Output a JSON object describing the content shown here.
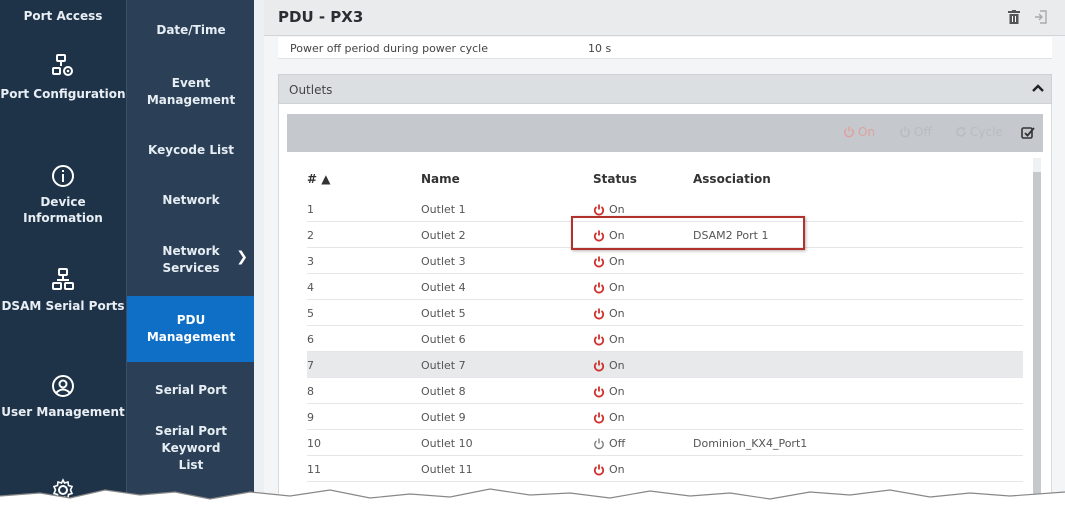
{
  "rail": {
    "items": [
      {
        "label": "Port Access",
        "icon": "port-access-icon"
      },
      {
        "label": "Port Configuration",
        "icon": "network-gear-icon"
      },
      {
        "label": "Device Information",
        "icon": "info-icon"
      },
      {
        "label": "DSAM Serial Ports",
        "icon": "serial-ports-icon"
      },
      {
        "label": "User Management",
        "icon": "user-icon"
      },
      {
        "label": "",
        "icon": "settings-gear-icon"
      }
    ]
  },
  "submenu": {
    "items": [
      {
        "label": "Date/Time"
      },
      {
        "label": "Event Management"
      },
      {
        "label": "Keycode List"
      },
      {
        "label": "Network"
      },
      {
        "label": "Network Services"
      },
      {
        "label": "PDU Management",
        "active": true
      },
      {
        "label": "Serial Port"
      },
      {
        "label": "Serial Port Keyword List"
      }
    ]
  },
  "header": {
    "title": "PDU - PX3",
    "delete_icon": "trash-icon",
    "exit_icon": "logout-icon"
  },
  "property": {
    "label": "Power off period during power cycle",
    "value": "10 s"
  },
  "outlets": {
    "section_title": "Outlets",
    "toolbar": {
      "on_label": "On",
      "off_label": "Off",
      "cycle_label": "Cycle"
    },
    "columns": {
      "num": "# ▲",
      "name": "Name",
      "status": "Status",
      "association": "Association"
    },
    "rows": [
      {
        "num": "1",
        "name": "Outlet 1",
        "status": "On",
        "association": ""
      },
      {
        "num": "2",
        "name": "Outlet 2",
        "status": "On",
        "association": "DSAM2 Port 1"
      },
      {
        "num": "3",
        "name": "Outlet 3",
        "status": "On",
        "association": ""
      },
      {
        "num": "4",
        "name": "Outlet 4",
        "status": "On",
        "association": ""
      },
      {
        "num": "5",
        "name": "Outlet 5",
        "status": "On",
        "association": ""
      },
      {
        "num": "6",
        "name": "Outlet 6",
        "status": "On",
        "association": ""
      },
      {
        "num": "7",
        "name": "Outlet 7",
        "status": "On",
        "association": ""
      },
      {
        "num": "8",
        "name": "Outlet 8",
        "status": "On",
        "association": ""
      },
      {
        "num": "9",
        "name": "Outlet 9",
        "status": "On",
        "association": ""
      },
      {
        "num": "10",
        "name": "Outlet 10",
        "status": "Off",
        "association": "Dominion_KX4_Port1"
      },
      {
        "num": "11",
        "name": "Outlet 11",
        "status": "On",
        "association": ""
      }
    ]
  },
  "colors": {
    "rail_bg": "#1f3348",
    "submenu_bg": "#2b4057",
    "active": "#0f6fc6",
    "power_on": "#d0312d",
    "callout": "#b3312c"
  }
}
